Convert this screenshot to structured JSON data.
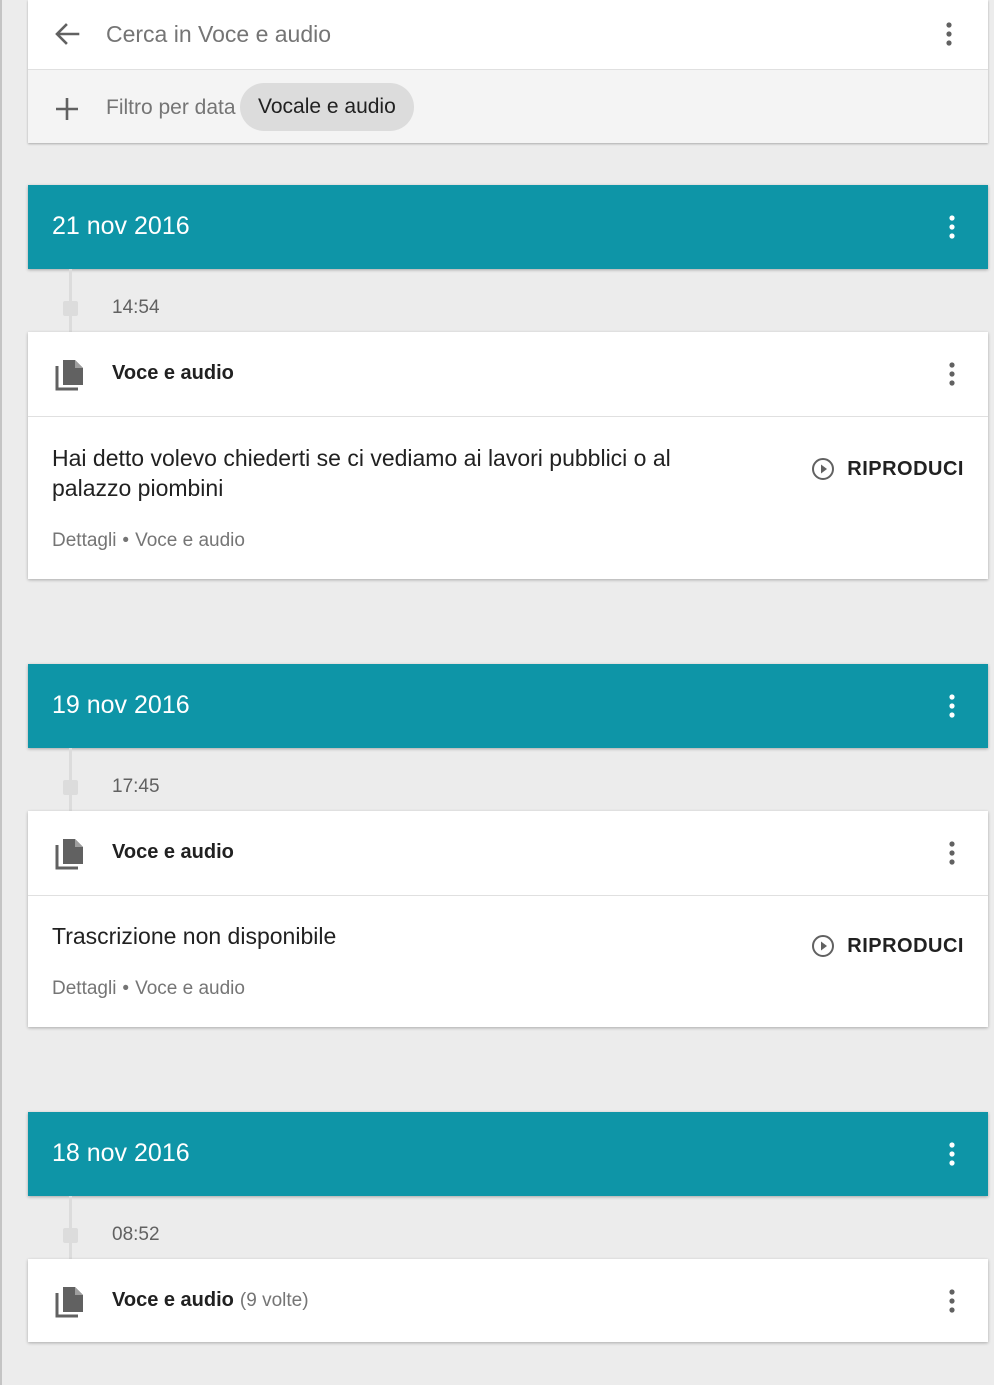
{
  "header": {
    "search_placeholder": "Cerca in Voce e audio",
    "filter_label": "Filtro per data",
    "chip_label": "Vocale e audio"
  },
  "colors": {
    "accent": "#0e95a7",
    "background": "#ececec"
  },
  "icons": [
    "back-arrow-icon",
    "more-vert-icon",
    "add-icon",
    "document-copy-icon",
    "play-circle-icon"
  ],
  "groups": [
    {
      "date": "21 nov 2016",
      "time": "14:54",
      "card_title": "Voce e audio",
      "transcript": "Hai detto volevo chiederti se ci vediamo ai lavori pubblici o al palazzo piombini",
      "play_label": "RIPRODUCI",
      "details": "Dettagli",
      "source": "Voce e audio"
    },
    {
      "date": "19 nov 2016",
      "time": "17:45",
      "card_title": "Voce e audio",
      "transcript": "Trascrizione non disponibile",
      "play_label": "RIPRODUCI",
      "details": "Dettagli",
      "source": "Voce e audio"
    },
    {
      "date": "18 nov 2016",
      "time": "08:52",
      "card_title": "Voce e audio",
      "count": "(9 volte)"
    }
  ]
}
